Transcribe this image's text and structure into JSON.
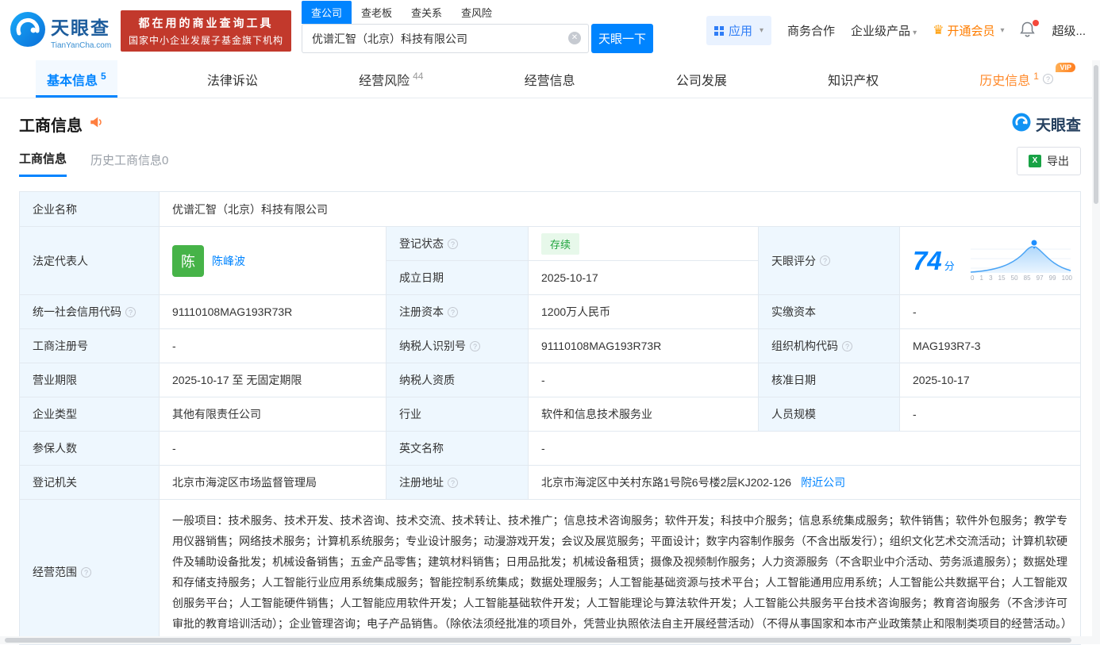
{
  "colors": {
    "primary_blue": "#0084ff",
    "banner_red": "#c2392c",
    "vip_orange": "#ff7d00",
    "status_green": "#1fa43d",
    "label_cell_bg": "#eef7fe",
    "avatar_green": "#46b348"
  },
  "icons": {
    "caret": "▾",
    "crown": "♛",
    "clear": "✕",
    "help": "?",
    "excel": "X"
  },
  "header": {
    "logo": {
      "name": "天眼查",
      "domain": "TianYanCha.com"
    },
    "banner": {
      "line1": "都在用的商业查询工具",
      "line2": "国家中小企业发展子基金旗下机构"
    },
    "search": {
      "tabs": [
        {
          "label": "查公司"
        },
        {
          "label": "查老板"
        },
        {
          "label": "查关系"
        },
        {
          "label": "查风险"
        }
      ],
      "value": "优谱汇智（北京）科技有限公司",
      "button": "天眼一下"
    },
    "right": {
      "apps": "应用",
      "biz": "商务合作",
      "enterprise": "企业级产品",
      "vip": "开通会员",
      "super": "超级..."
    }
  },
  "nav": {
    "tabs": [
      {
        "label": "基本信息",
        "count": "5"
      },
      {
        "label": "法律诉讼",
        "count": ""
      },
      {
        "label": "经营风险",
        "count": "44"
      },
      {
        "label": "经营信息",
        "count": ""
      },
      {
        "label": "公司发展",
        "count": ""
      },
      {
        "label": "知识产权",
        "count": ""
      },
      {
        "label": "历史信息",
        "count": "1",
        "badge": "VIP"
      }
    ]
  },
  "section": {
    "title": "工商信息",
    "brand": "天眼查"
  },
  "subtabs": {
    "current": "工商信息",
    "history": "历史工商信息0",
    "export": "导出"
  },
  "table": {
    "company_name": {
      "label": "企业名称",
      "value": "优谱汇智（北京）科技有限公司"
    },
    "legal_rep": {
      "label": "法定代表人",
      "avatar": "陈",
      "name": "陈峰波"
    },
    "reg_status": {
      "label": "登记状态",
      "value": "存续"
    },
    "establish_date": {
      "label": "成立日期",
      "value": "2025-10-17"
    },
    "score": {
      "label": "天眼评分",
      "value": "74",
      "unit": "分",
      "axis": [
        "0",
        "1",
        "3",
        "15",
        "50",
        "85",
        "97",
        "99",
        "100"
      ]
    },
    "credit_code": {
      "label": "统一社会信用代码",
      "value": "91110108MAG193R73R"
    },
    "reg_capital": {
      "label": "注册资本",
      "value": "1200万人民币"
    },
    "paid_capital": {
      "label": "实缴资本",
      "value": "-"
    },
    "reg_no": {
      "label": "工商注册号",
      "value": "-"
    },
    "taxpayer_no": {
      "label": "纳税人识别号",
      "value": "91110108MAG193R73R"
    },
    "org_code": {
      "label": "组织机构代码",
      "value": "MAG193R7-3"
    },
    "term": {
      "label": "营业期限",
      "value": "2025-10-17 至 无固定期限"
    },
    "taxpayer_quality": {
      "label": "纳税人资质",
      "value": "-"
    },
    "approve_date": {
      "label": "核准日期",
      "value": "2025-10-17"
    },
    "company_type": {
      "label": "企业类型",
      "value": "其他有限责任公司"
    },
    "industry": {
      "label": "行业",
      "value": "软件和信息技术服务业"
    },
    "staff": {
      "label": "人员规模",
      "value": "-"
    },
    "insured": {
      "label": "参保人数",
      "value": "-"
    },
    "english_name": {
      "label": "英文名称",
      "value": "-"
    },
    "authority": {
      "label": "登记机关",
      "value": "北京市海淀区市场监督管理局"
    },
    "address": {
      "label": "注册地址",
      "value": "北京市海淀区中关村东路1号院6号楼2层KJ202-126",
      "nearby": "附近公司"
    },
    "scope": {
      "label": "经营范围",
      "value": "一般项目：技术服务、技术开发、技术咨询、技术交流、技术转让、技术推广；信息技术咨询服务；软件开发；科技中介服务；信息系统集成服务；软件销售；软件外包服务；教学专用仪器销售；网络技术服务；计算机系统服务；专业设计服务；动漫游戏开发；会议及展览服务；平面设计；数字内容制作服务（不含出版发行）；组织文化艺术交流活动；计算机软硬件及辅助设备批发；机械设备销售；五金产品零售；建筑材料销售；日用品批发；机械设备租赁；摄像及视频制作服务；人力资源服务（不含职业中介活动、劳务派遣服务）；数据处理和存储支持服务；人工智能行业应用系统集成服务；智能控制系统集成；数据处理服务；人工智能基础资源与技术平台；人工智能通用应用系统；人工智能公共数据平台；人工智能双创服务平台；人工智能硬件销售；人工智能应用软件开发；人工智能基础软件开发；人工智能理论与算法软件开发；人工智能公共服务平台技术咨询服务；教育咨询服务（不含涉许可审批的教育培训活动）；企业管理咨询；电子产品销售。（除依法须经批准的项目外，凭营业执照依法自主开展经营活动）（不得从事国家和本市产业政策禁止和限制类项目的经营活动。）"
    }
  }
}
